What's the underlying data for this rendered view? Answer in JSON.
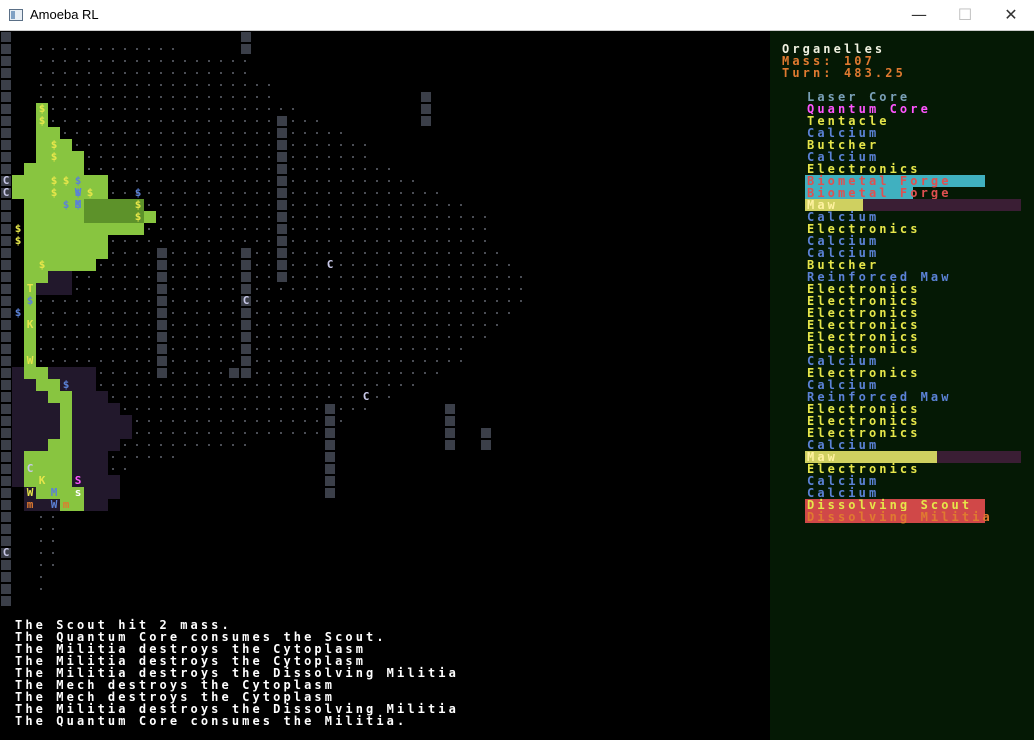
{
  "window": {
    "title": "Amoeba RL",
    "minimize": "—",
    "maximize": "☐",
    "close": "✕"
  },
  "colors": {
    "wall": "#3b3f49",
    "wall_hash": "#8c909a",
    "floor_dot": "#4a4d55",
    "cytoplasm": "#88c540",
    "cytoplasm_dark": "#5d922a",
    "explored": "#22182c",
    "dollar": "#e6e64a",
    "blue": "#5b82d6",
    "door_c": "#c8c8e8",
    "orange": "#e07a30",
    "pink": "#ff55ff",
    "white": "#ffffff"
  },
  "map": {
    "glyphs": [
      {
        "ch": "C",
        "kind": "door"
      },
      {
        "ch": "C",
        "kind": "door"
      },
      {
        "ch": "C",
        "kind": "door"
      },
      {
        "ch": "C",
        "kind": "door"
      },
      {
        "ch": "C",
        "kind": "door"
      },
      {
        "ch": "C",
        "kind": "door"
      },
      {
        "ch": "C",
        "kind": "door"
      },
      {
        "ch": "$",
        "kind": "dollar"
      },
      {
        "ch": "$",
        "kind": "dollar"
      },
      {
        "ch": "$",
        "kind": "dollar"
      },
      {
        "ch": "$",
        "kind": "dollar"
      },
      {
        "ch": "$",
        "kind": "dollar"
      },
      {
        "ch": "$",
        "kind": "dollar"
      },
      {
        "ch": "$",
        "kind": "dollar"
      },
      {
        "ch": "$",
        "kind": "dollar"
      },
      {
        "ch": "$",
        "kind": "dollar"
      },
      {
        "ch": "$",
        "kind": "dollar"
      },
      {
        "ch": "$",
        "kind": "dollar"
      },
      {
        "ch": "$",
        "kind": "dollar"
      },
      {
        "ch": "$",
        "kind": "dollar"
      },
      {
        "ch": "$",
        "kind": "blue"
      },
      {
        "ch": "$",
        "kind": "blue"
      },
      {
        "ch": "$",
        "kind": "blue"
      },
      {
        "ch": "$",
        "kind": "blue"
      },
      {
        "ch": "$",
        "kind": "blue"
      },
      {
        "ch": "$",
        "kind": "blue"
      },
      {
        "ch": "$",
        "kind": "blue"
      },
      {
        "ch": "$",
        "kind": "blue"
      },
      {
        "ch": "M",
        "kind": "blue"
      },
      {
        "ch": "W",
        "kind": "blue"
      },
      {
        "ch": "W",
        "kind": "blue"
      },
      {
        "ch": "M",
        "kind": "blue"
      },
      {
        "ch": "T",
        "kind": "dollar"
      },
      {
        "ch": "K",
        "kind": "dollar"
      },
      {
        "ch": "W",
        "kind": "dollar"
      },
      {
        "ch": "K",
        "kind": "dollar"
      },
      {
        "ch": "W",
        "kind": "dollar"
      },
      {
        "ch": "m",
        "kind": "orange"
      },
      {
        "ch": "m",
        "kind": "orange"
      },
      {
        "ch": "s",
        "kind": "white"
      },
      {
        "ch": "S",
        "kind": "pink"
      }
    ]
  },
  "sidebar": {
    "title": "Organelles",
    "mass_label": "Mass: 107",
    "turn_label": "Turn: 483.25",
    "organelles": [
      {
        "label": "Laser Core",
        "color": "#7aa0b8",
        "bar": null
      },
      {
        "label": "Quantum Core",
        "color": "#ff55ff",
        "bar": null
      },
      {
        "label": "Tentacle",
        "color": "#e6e64a",
        "bar": null
      },
      {
        "label": "Calcium",
        "color": "#5b82d6",
        "bar": null
      },
      {
        "label": "Butcher",
        "color": "#e6e64a",
        "bar": null
      },
      {
        "label": "Calcium",
        "color": "#5b82d6",
        "bar": null
      },
      {
        "label": "Electronics",
        "color": "#e6e64a",
        "bar": null
      },
      {
        "label": "Biometal Forge",
        "color": "#e05050",
        "bar": {
          "fill": "#40b0c0",
          "frac": 1.0,
          "rest": null
        }
      },
      {
        "label": "Biometal Forge",
        "color": "#e05050",
        "bar": {
          "fill": "#40b0c0",
          "frac": 0.6,
          "rest": null
        }
      },
      {
        "label": "Maw",
        "color": "#fff2a0",
        "bar": {
          "fill": "#cfd060",
          "frac": 0.27,
          "rest": "#3a1e34"
        }
      },
      {
        "label": "Calcium",
        "color": "#5b82d6",
        "bar": null
      },
      {
        "label": "Electronics",
        "color": "#e6e64a",
        "bar": null
      },
      {
        "label": "Calcium",
        "color": "#5b82d6",
        "bar": null
      },
      {
        "label": "Calcium",
        "color": "#5b82d6",
        "bar": null
      },
      {
        "label": "Butcher",
        "color": "#e6e64a",
        "bar": null
      },
      {
        "label": "Reinforced Maw",
        "color": "#5b82d6",
        "bar": null
      },
      {
        "label": "Electronics",
        "color": "#e6e64a",
        "bar": null
      },
      {
        "label": "Electronics",
        "color": "#e6e64a",
        "bar": null
      },
      {
        "label": "Electronics",
        "color": "#e6e64a",
        "bar": null
      },
      {
        "label": "Electronics",
        "color": "#e6e64a",
        "bar": null
      },
      {
        "label": "Electronics",
        "color": "#e6e64a",
        "bar": null
      },
      {
        "label": "Electronics",
        "color": "#e6e64a",
        "bar": null
      },
      {
        "label": "Calcium",
        "color": "#5b82d6",
        "bar": null
      },
      {
        "label": "Electronics",
        "color": "#e6e64a",
        "bar": null
      },
      {
        "label": "Calcium",
        "color": "#5b82d6",
        "bar": null
      },
      {
        "label": "Reinforced Maw",
        "color": "#5b82d6",
        "bar": null
      },
      {
        "label": "Electronics",
        "color": "#e6e64a",
        "bar": null
      },
      {
        "label": "Electronics",
        "color": "#e6e64a",
        "bar": null
      },
      {
        "label": "Electronics",
        "color": "#e6e64a",
        "bar": null
      },
      {
        "label": "Calcium",
        "color": "#5b82d6",
        "bar": null
      },
      {
        "label": "Maw",
        "color": "#fff2a0",
        "bar": {
          "fill": "#cfd060",
          "frac": 0.61,
          "rest": "#3a1e34"
        }
      },
      {
        "label": "Electronics",
        "color": "#e6e64a",
        "bar": null
      },
      {
        "label": "Calcium",
        "color": "#5b82d6",
        "bar": null
      },
      {
        "label": "Calcium",
        "color": "#5b82d6",
        "bar": null
      },
      {
        "label": "Dissolving Scout",
        "color": "#e6e64a",
        "bar": {
          "fill": "#d04848",
          "frac": 1.0,
          "rest": null
        }
      },
      {
        "label": "Dissolving Militia",
        "color": "#e07a30",
        "bar": {
          "fill": "#d04848",
          "frac": 1.0,
          "rest": null
        }
      }
    ]
  },
  "messages": [
    "The Scout hit 2 mass.",
    "The Quantum Core consumes the Scout.",
    "The Militia destroys the Cytoplasm",
    "The Militia destroys the Cytoplasm",
    "The Militia destroys the Dissolving Militia",
    "The Mech destroys the Cytoplasm",
    "The Mech destroys the Cytoplasm",
    "The Militia destroys the Dissolving Militia",
    "The Quantum Core consumes the Militia."
  ]
}
